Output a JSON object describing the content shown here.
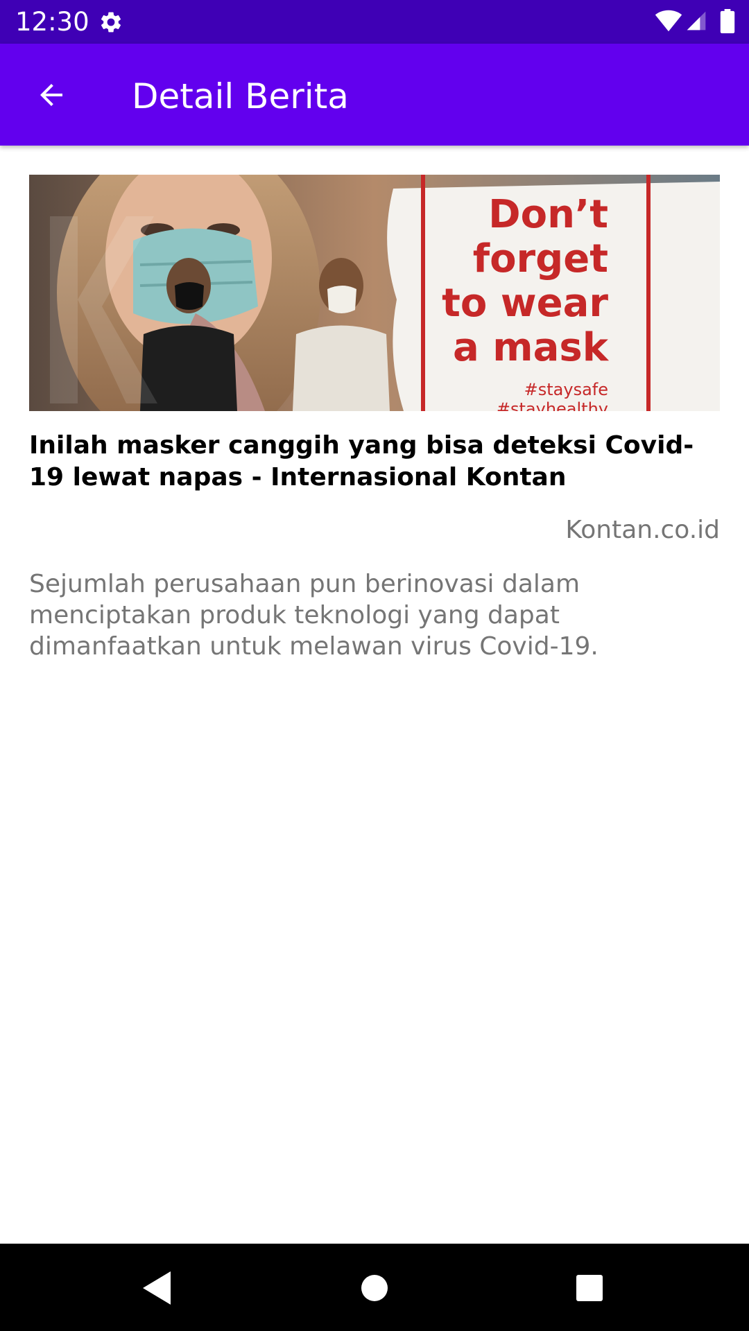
{
  "status_bar": {
    "time": "12:30",
    "icons": [
      "gear-icon",
      "wifi-icon",
      "signal-icon",
      "battery-icon"
    ],
    "background_color": "#3f00b5"
  },
  "app_bar": {
    "title": "Detail Berita",
    "back_icon": "arrow-back-icon",
    "background_color": "#6200ee"
  },
  "article": {
    "image": {
      "sign_text_lines": [
        "Don’t",
        "forget",
        "to wear",
        "a mask"
      ],
      "hashtags": [
        "#staysafe",
        "#stayhealthy"
      ]
    },
    "title": "Inilah masker canggih yang bisa deteksi Covid-19 lewat napas - Internasional Kontan",
    "source": "Kontan.co.id",
    "description": "Sejumlah perusahaan pun berinovasi dalam menciptakan produk teknologi yang dapat dimanfaatkan untuk melawan virus Covid-19."
  },
  "nav_bar": {
    "buttons": [
      "nav-back-icon",
      "nav-home-icon",
      "nav-recents-icon"
    ]
  }
}
